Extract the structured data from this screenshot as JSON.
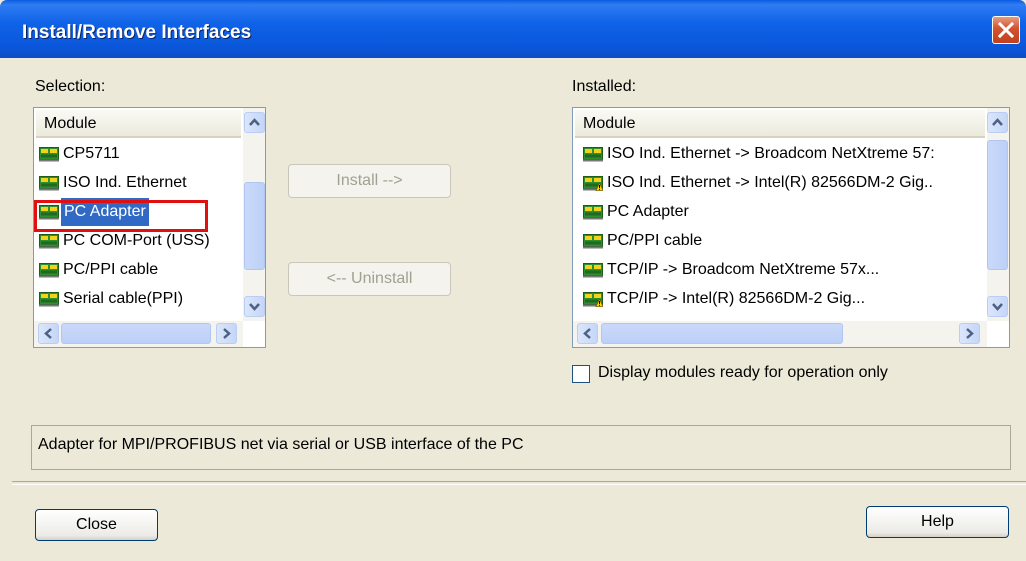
{
  "window": {
    "title": "Install/Remove Interfaces"
  },
  "selection": {
    "label": "Selection:",
    "column_header": "Module",
    "items": [
      {
        "label": "CP5711",
        "icon": "module-icon"
      },
      {
        "label": "ISO Ind. Ethernet",
        "icon": "module-icon"
      },
      {
        "label": "PC Adapter",
        "icon": "module-icon",
        "selected": true
      },
      {
        "label": "PC COM-Port (USS)",
        "icon": "module-icon"
      },
      {
        "label": "PC/PPI cable",
        "icon": "module-icon"
      },
      {
        "label": "Serial cable(PPI)",
        "icon": "module-icon"
      }
    ]
  },
  "buttons": {
    "install": "Install -->",
    "uninstall": "<-- Uninstall",
    "close": "Close",
    "help": "Help"
  },
  "installed": {
    "label": "Installed:",
    "column_header": "Module",
    "items": [
      {
        "label": "ISO Ind. Ethernet -> Broadcom NetXtreme 57:",
        "icon": "module-icon"
      },
      {
        "label": "ISO Ind. Ethernet -> Intel(R) 82566DM-2 Gig..",
        "icon": "module-warning-icon"
      },
      {
        "label": "PC Adapter",
        "icon": "module-icon"
      },
      {
        "label": "PC/PPI cable",
        "icon": "module-icon"
      },
      {
        "label": "TCP/IP -> Broadcom NetXtreme 57x...",
        "icon": "module-icon"
      },
      {
        "label": "TCP/IP -> Intel(R) 82566DM-2 Gig...",
        "icon": "module-warning-icon"
      }
    ]
  },
  "filter": {
    "label": "Display modules ready for operation only",
    "checked": false
  },
  "description": "Adapter for MPI/PROFIBUS net via serial or USB interface of the PC",
  "colors": {
    "titlebar": "#0a55d8",
    "selection": "#316ac5",
    "highlight": "#e01010",
    "dialog": "#ece9d8"
  }
}
